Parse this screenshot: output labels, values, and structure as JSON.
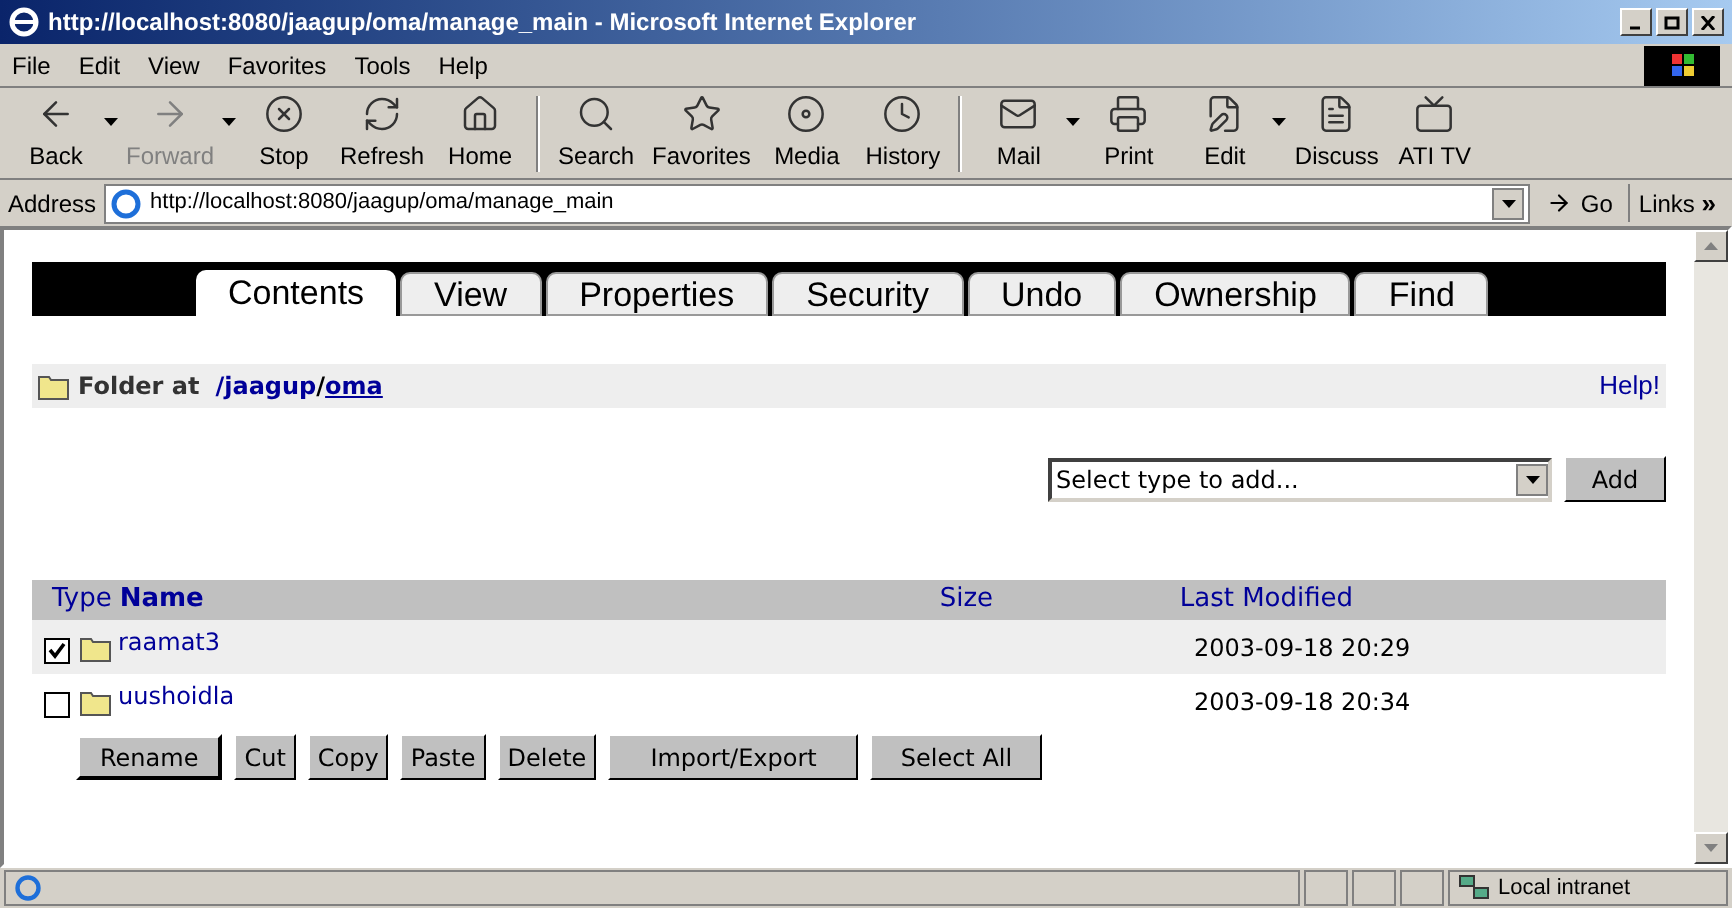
{
  "window": {
    "title": "http://localhost:8080/jaagup/oma/manage_main - Microsoft Internet Explorer"
  },
  "menu": [
    "File",
    "Edit",
    "View",
    "Favorites",
    "Tools",
    "Help"
  ],
  "toolbar": [
    {
      "kind": "back",
      "label": "Back",
      "disabled": false,
      "dropdown": true
    },
    {
      "kind": "forward",
      "label": "Forward",
      "disabled": true,
      "dropdown": true
    },
    {
      "kind": "stop",
      "label": "Stop",
      "disabled": false,
      "dropdown": false
    },
    {
      "kind": "refresh",
      "label": "Refresh",
      "disabled": false,
      "dropdown": false
    },
    {
      "kind": "home",
      "label": "Home",
      "disabled": false,
      "dropdown": false
    },
    {
      "kind": "search",
      "label": "Search",
      "disabled": false,
      "dropdown": false
    },
    {
      "kind": "favorites",
      "label": "Favorites",
      "disabled": false,
      "dropdown": false
    },
    {
      "kind": "media",
      "label": "Media",
      "disabled": false,
      "dropdown": false
    },
    {
      "kind": "history",
      "label": "History",
      "disabled": false,
      "dropdown": false
    },
    {
      "kind": "mail",
      "label": "Mail",
      "disabled": false,
      "dropdown": true
    },
    {
      "kind": "print",
      "label": "Print",
      "disabled": false,
      "dropdown": false
    },
    {
      "kind": "edit",
      "label": "Edit",
      "disabled": false,
      "dropdown": true
    },
    {
      "kind": "discuss",
      "label": "Discuss",
      "disabled": false,
      "dropdown": false
    },
    {
      "kind": "tv",
      "label": "ATI TV",
      "disabled": false,
      "dropdown": false
    }
  ],
  "address": {
    "label": "Address",
    "value": "http://localhost:8080/jaagup/oma/manage_main",
    "go": "Go",
    "links": "Links",
    "links_chevron": "»"
  },
  "tabs": [
    {
      "label": "Contents",
      "selected": true
    },
    {
      "label": "View",
      "selected": false
    },
    {
      "label": "Properties",
      "selected": false
    },
    {
      "label": "Security",
      "selected": false
    },
    {
      "label": "Undo",
      "selected": false
    },
    {
      "label": "Ownership",
      "selected": false
    },
    {
      "label": "Find",
      "selected": false
    }
  ],
  "location": {
    "prefix": "Folder at",
    "path": "/jaagup",
    "separator": "/",
    "current": "oma",
    "help": "Help!"
  },
  "add": {
    "placeholder": "Select type to add...",
    "button": "Add"
  },
  "table": {
    "columns": [
      "Type",
      "Name",
      "Size",
      "Last Modified"
    ],
    "rows": [
      {
        "checked": true,
        "name": "raamat3",
        "modified": "2003-09-18 20:29"
      },
      {
        "checked": false,
        "name": "uushoidla",
        "modified": "2003-09-18 20:34"
      }
    ]
  },
  "actions": [
    "Rename",
    "Cut",
    "Copy",
    "Paste",
    "Delete",
    "Import/Export",
    "Select All"
  ],
  "status_bar": {
    "zone": "Local intranet"
  }
}
